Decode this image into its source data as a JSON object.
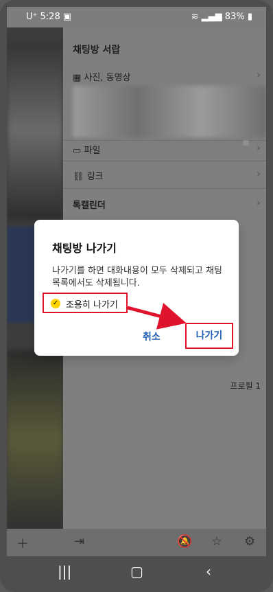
{
  "status": {
    "carrier": "U⁺",
    "time": "5:28",
    "battery": "83%"
  },
  "drawer": {
    "title": "채팅방 서랍",
    "items": [
      {
        "label": "사진, 동영상"
      },
      {
        "label": "파일"
      },
      {
        "label": "링크"
      },
      {
        "label": "톡캘린더"
      }
    ],
    "profile_label": "프로필 1"
  },
  "dialog": {
    "title": "채팅방 나가기",
    "message": "나가기를 하면 대화내용이 모두 삭제되고 채팅목록에서도 삭제됩니다.",
    "quiet_option": "조용히 나가기",
    "quiet_checked": true,
    "cancel_label": "취소",
    "leave_label": "나가기"
  },
  "colors": {
    "accent": "#1f5fb6",
    "highlight": "#e0132d",
    "check": "#ffd400"
  },
  "icons": {
    "plus": "plus-icon",
    "bell": "bell-icon",
    "star": "star-icon",
    "gear": "gear-icon"
  }
}
